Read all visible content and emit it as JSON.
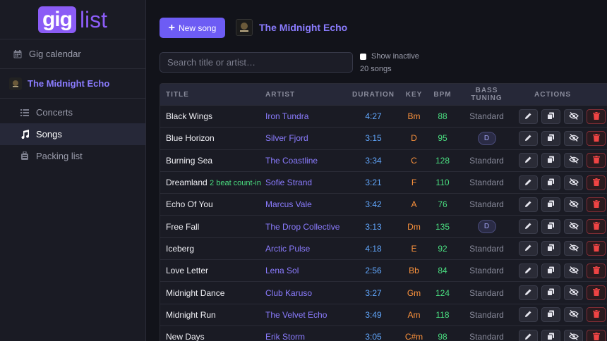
{
  "logo": {
    "part1": "gig",
    "part2": "list"
  },
  "sidebar": {
    "gig_calendar": "Gig calendar",
    "band_name": "The Midnight Echo",
    "items": [
      {
        "label": "Concerts",
        "icon": "list-icon",
        "active": false
      },
      {
        "label": "Songs",
        "icon": "music-note-icon",
        "active": true
      },
      {
        "label": "Packing list",
        "icon": "luggage-icon",
        "active": false
      }
    ]
  },
  "header": {
    "new_song_label": "New song",
    "band_name": "The Midnight Echo"
  },
  "search": {
    "placeholder": "Search title or artist…",
    "show_inactive_label": "Show inactive",
    "count_text": "20 songs"
  },
  "table": {
    "columns": {
      "title": "TITLE",
      "artist": "ARTIST",
      "duration": "DURATION",
      "key": "KEY",
      "bpm": "BPM",
      "tuning": "BASS TUNING",
      "actions": "ACTIONS"
    },
    "rows": [
      {
        "title": "Black Wings",
        "note": "",
        "artist": "Iron Tundra",
        "duration": "4:27",
        "key": "Bm",
        "bpm": "88",
        "tuning": "Standard",
        "tuning_pill": false
      },
      {
        "title": "Blue Horizon",
        "note": "",
        "artist": "Silver Fjord",
        "duration": "3:15",
        "key": "D",
        "bpm": "95",
        "tuning": "D",
        "tuning_pill": true
      },
      {
        "title": "Burning Sea",
        "note": "",
        "artist": "The Coastline",
        "duration": "3:34",
        "key": "C",
        "bpm": "128",
        "tuning": "Standard",
        "tuning_pill": false
      },
      {
        "title": "Dreamland",
        "note": "2 beat count-in",
        "artist": "Sofie Strand",
        "duration": "3:21",
        "key": "F",
        "bpm": "110",
        "tuning": "Standard",
        "tuning_pill": false
      },
      {
        "title": "Echo Of You",
        "note": "",
        "artist": "Marcus Vale",
        "duration": "3:42",
        "key": "A",
        "bpm": "76",
        "tuning": "Standard",
        "tuning_pill": false
      },
      {
        "title": "Free Fall",
        "note": "",
        "artist": "The Drop Collective",
        "duration": "3:13",
        "key": "Dm",
        "bpm": "135",
        "tuning": "D",
        "tuning_pill": true
      },
      {
        "title": "Iceberg",
        "note": "",
        "artist": "Arctic Pulse",
        "duration": "4:18",
        "key": "E",
        "bpm": "92",
        "tuning": "Standard",
        "tuning_pill": false
      },
      {
        "title": "Love Letter",
        "note": "",
        "artist": "Lena Sol",
        "duration": "2:56",
        "key": "Bb",
        "bpm": "84",
        "tuning": "Standard",
        "tuning_pill": false
      },
      {
        "title": "Midnight Dance",
        "note": "",
        "artist": "Club Karuso",
        "duration": "3:27",
        "key": "Gm",
        "bpm": "124",
        "tuning": "Standard",
        "tuning_pill": false
      },
      {
        "title": "Midnight Run",
        "note": "",
        "artist": "The Velvet Echo",
        "duration": "3:49",
        "key": "Am",
        "bpm": "118",
        "tuning": "Standard",
        "tuning_pill": false
      },
      {
        "title": "New Days",
        "note": "",
        "artist": "Erik Storm",
        "duration": "3:05",
        "key": "C#m",
        "bpm": "98",
        "tuning": "Standard",
        "tuning_pill": false
      }
    ]
  },
  "colors": {
    "accent": "#8b5cf6",
    "button": "#6d5cf4",
    "artist": "#8b7cff",
    "duration": "#60a5fa",
    "key": "#fb923c",
    "bpm": "#4ade80",
    "delete": "#ef4444"
  }
}
